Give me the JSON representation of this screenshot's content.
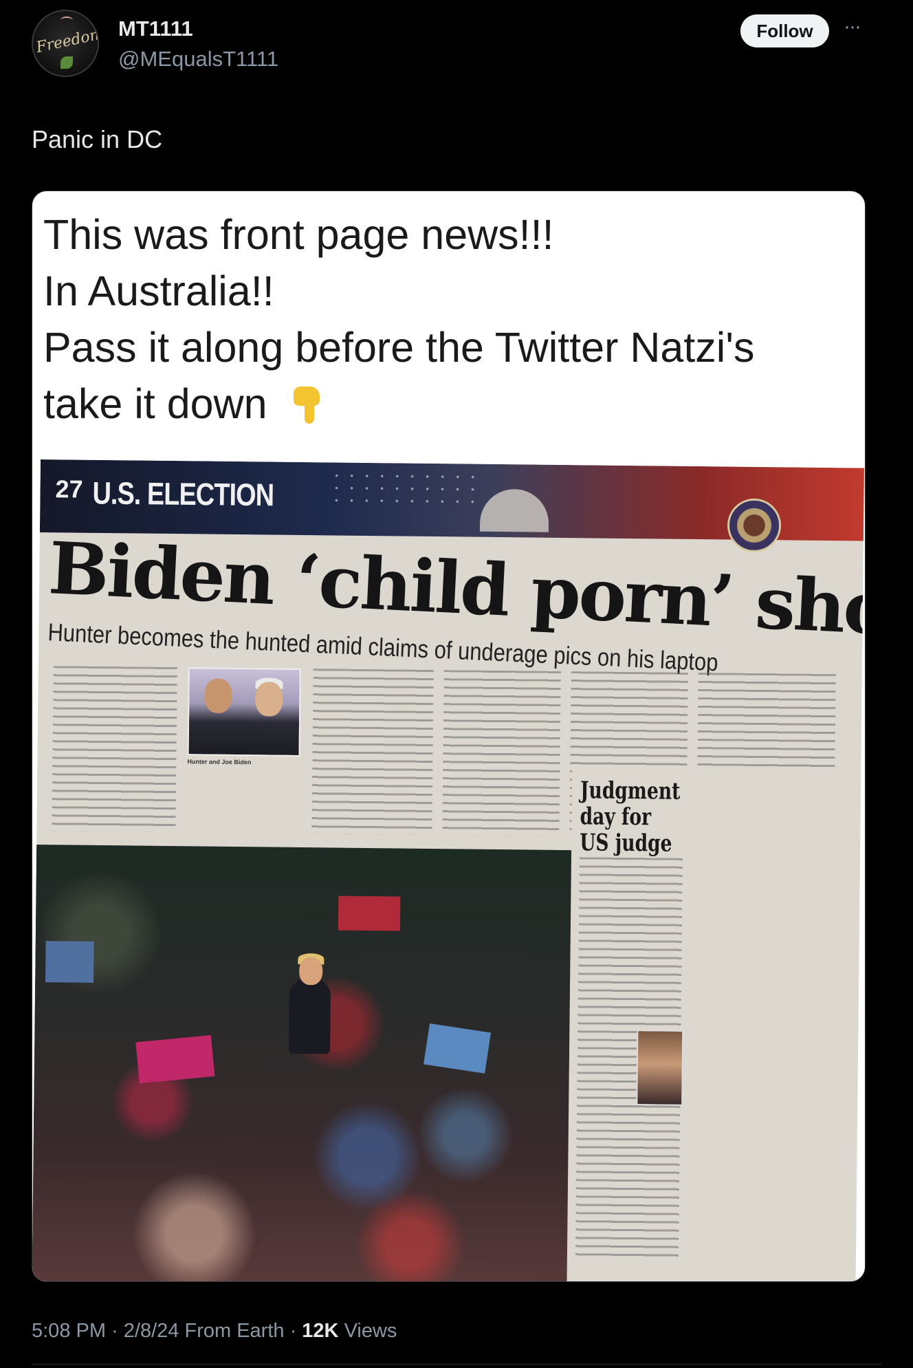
{
  "author": {
    "display_name": "MT1111",
    "handle": "@MEqualsT1111",
    "avatar_text": "Freedom"
  },
  "actions": {
    "follow_label": "Follow",
    "more_icon": "more-horizontal-icon"
  },
  "tweet": {
    "text": "Panic in DC"
  },
  "media": {
    "meme_lines": [
      "This was front page news!!!",
      "In Australia!!",
      "Pass it along before the Twitter Natzi's",
      "take it down"
    ],
    "meme_emoji": "pointing-down-icon",
    "newspaper": {
      "page_number": "27",
      "section": "U.S. ELECTION",
      "headline": "Biden ‘child porn’ shock",
      "subheadline": "Hunter becomes the hunted amid claims of underage pics on his laptop",
      "inset_caption": "Hunter and Joe Biden",
      "sidebar_headline_lines": [
        "Judgment",
        "day for",
        "US judge"
      ]
    }
  },
  "footer": {
    "time": "5:08 PM",
    "date": "2/8/24",
    "source": "From Earth",
    "views_count": "12K",
    "views_label": "Views"
  }
}
